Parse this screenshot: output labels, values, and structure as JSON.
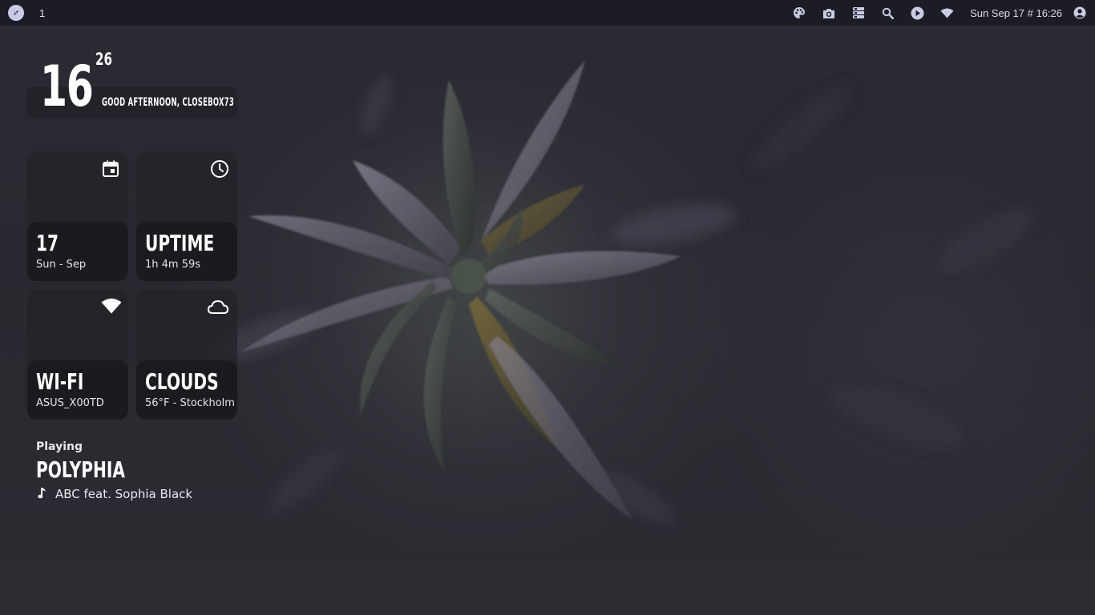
{
  "topbar": {
    "launcher_icon": "compass-icon",
    "workspace": "1",
    "tray_icons": [
      "palette-icon",
      "camera-icon",
      "dashboard-icon",
      "search-icon",
      "play-icon",
      "wifi-icon"
    ],
    "datetime": "Sun Sep 17 # 16:26",
    "user_icon": "account-circle-icon"
  },
  "clock": {
    "hour": "16",
    "minute": "26",
    "greeting": "GOOD AFTERNOON, CLOSEBOX73"
  },
  "tiles": {
    "calendar": {
      "icon": "calendar-icon",
      "title": "17",
      "subtitle": "Sun - Sep"
    },
    "uptime": {
      "icon": "clock-icon",
      "title": "UPTIME",
      "subtitle": "1h 4m 59s"
    },
    "wifi": {
      "icon": "wifi-icon",
      "title": "WI-FI",
      "subtitle": "ASUS_X00TD"
    },
    "weather": {
      "icon": "cloud-icon",
      "title": "CLOUDS",
      "subtitle": "56°F - Stockholm"
    }
  },
  "now_playing": {
    "label": "Playing",
    "artist": "POLYPHIA",
    "track_icon": "music-note-icon",
    "track": "ABC feat. Sophia Black"
  },
  "colors": {
    "topbar_bg": "#1c1c24",
    "icon_tint": "#c9cbe6",
    "tile_bg": "#222228",
    "tile_bottom_bg": "#1b1b1f"
  }
}
